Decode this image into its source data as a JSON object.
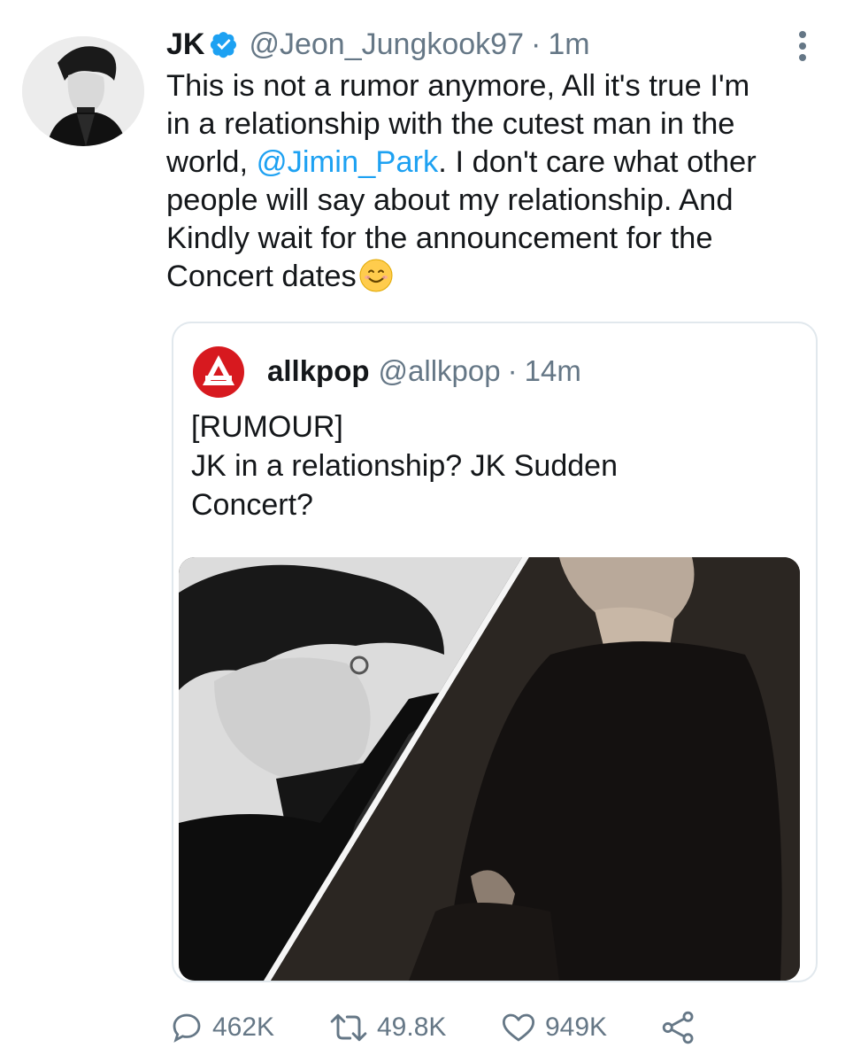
{
  "tweet": {
    "display_name": "JK",
    "handle": "@Jeon_Jungkook97",
    "separator": "·",
    "time": "1m",
    "text_part1": "This is not a rumor anymore, All it's true I'm\nin a relationship with the cutest man in the\nworld, ",
    "mention": "@Jimin_Park",
    "text_part2": ". I don't care what other\npeople will say about my relationship. And\nKindly wait for the announcement for the\nConcert dates",
    "emoji": "smiling-face-emoji"
  },
  "quoted_tweet": {
    "display_name": "allkpop",
    "handle": "@allkpop",
    "separator": "·",
    "time": "14m",
    "lines": [
      "[RUMOUR]",
      "JK in a relationship? JK Sudden",
      "Concert?"
    ]
  },
  "actions": {
    "reply_count": "462K",
    "retweet_count": "49.8K",
    "like_count": "949K"
  },
  "colors": {
    "link": "#1da1f2",
    "muted": "#657786",
    "allkpop_red": "#d7191f",
    "verified": "#1da1f2"
  }
}
